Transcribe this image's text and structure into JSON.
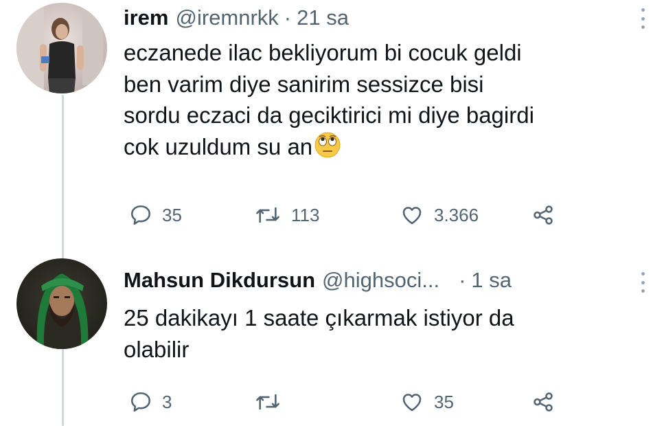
{
  "tweets": [
    {
      "name": "irem",
      "handle": "@iremnrkk",
      "separator": "·",
      "time": "21 sa",
      "text_lines": [
        "eczanede ilac bekliyorum bi cocuk geldi",
        "ben varim diye sanirim sessizce bisi",
        "sordu eczaci da geciktirici mi diye bagirdi",
        "cok uzuldum su an"
      ],
      "emoji": "face-with-rolling-eyes",
      "replies": "35",
      "retweets": "113",
      "likes": "3.366"
    },
    {
      "name": "Mahsun Dikdursun",
      "handle": "@highsoci...",
      "separator": "·",
      "time": "1 sa",
      "text_lines": [
        "25 dakikayı 1 saate çıkarmak istiyor da",
        "olabilir"
      ],
      "replies": "3",
      "retweets": "",
      "likes": "35"
    }
  ],
  "colors": {
    "text": "#0f1419",
    "muted": "#536471",
    "thread_line": "#cfd9de"
  }
}
